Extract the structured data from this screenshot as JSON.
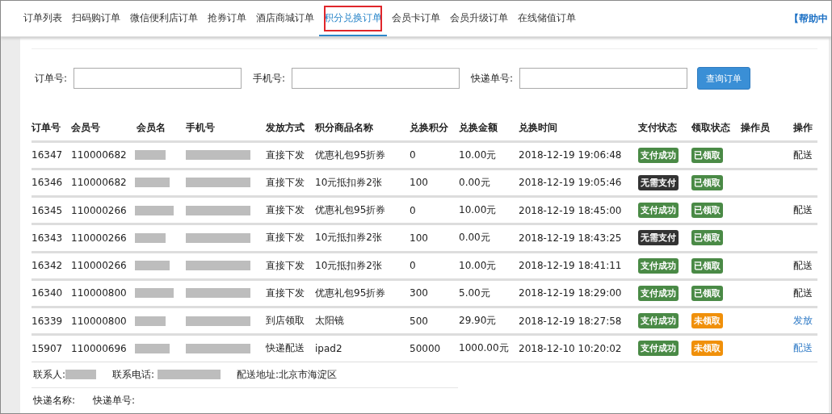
{
  "tabs": [
    {
      "label": "订单列表",
      "selected": false
    },
    {
      "label": "扫码购订单",
      "selected": false
    },
    {
      "label": "微信便利店订单",
      "selected": false
    },
    {
      "label": "抢券订单",
      "selected": false
    },
    {
      "label": "酒店商城订单",
      "selected": false
    },
    {
      "label": "积分兑换订单",
      "selected": true
    },
    {
      "label": "会员卡订单",
      "selected": false
    },
    {
      "label": "会员升级订单",
      "selected": false
    },
    {
      "label": "在线储值订单",
      "selected": false
    }
  ],
  "help_link": "【帮助中",
  "search": {
    "fields": [
      {
        "label": "订单号:"
      },
      {
        "label": "手机号:"
      },
      {
        "label": "快递单号:"
      }
    ],
    "button": "查询订单"
  },
  "table": {
    "columns": [
      "订单号",
      "会员号",
      "会员名",
      "手机号",
      "发放方式",
      "积分商品名称",
      "兑换积分",
      "兑换金额",
      "兑换时间",
      "支付状态",
      "领取状态",
      "操作员",
      "操作"
    ],
    "rows": [
      {
        "order_no": "16347",
        "member_no": "110000682",
        "method": "直接下发",
        "product": "优惠礼包95折券",
        "points": "0",
        "amount": "10.00元",
        "time": "2018-12-19 19:06:48",
        "pay_status": {
          "text": "支付成功",
          "color": "#4a8a46"
        },
        "pickup_status": {
          "text": "已领取",
          "color": "#4a8a46"
        },
        "action": {
          "text": "配送",
          "kind": "text"
        }
      },
      {
        "order_no": "16346",
        "member_no": "110000682",
        "method": "直接下发",
        "product": "10元抵扣券2张",
        "points": "100",
        "amount": "0.00元",
        "time": "2018-12-19 19:05:46",
        "pay_status": {
          "text": "无需支付",
          "color": "#333333"
        },
        "pickup_status": {
          "text": "已领取",
          "color": "#4a8a46"
        }
      },
      {
        "order_no": "16345",
        "member_no": "110000266",
        "method": "直接下发",
        "product": "优惠礼包95折券",
        "points": "0",
        "amount": "10.00元",
        "time": "2018-12-19 18:45:00",
        "pay_status": {
          "text": "支付成功",
          "color": "#4a8a46"
        },
        "pickup_status": {
          "text": "已领取",
          "color": "#4a8a46"
        },
        "action": {
          "text": "配送",
          "kind": "text"
        }
      },
      {
        "order_no": "16343",
        "member_no": "110000266",
        "method": "直接下发",
        "product": "10元抵扣券2张",
        "points": "100",
        "amount": "0.00元",
        "time": "2018-12-19 18:43:25",
        "pay_status": {
          "text": "无需支付",
          "color": "#333333"
        },
        "pickup_status": {
          "text": "已领取",
          "color": "#4a8a46"
        }
      },
      {
        "order_no": "16342",
        "member_no": "110000266",
        "method": "直接下发",
        "product": "10元抵扣券2张",
        "points": "0",
        "amount": "10.00元",
        "time": "2018-12-19 18:41:11",
        "pay_status": {
          "text": "支付成功",
          "color": "#4a8a46"
        },
        "pickup_status": {
          "text": "已领取",
          "color": "#4a8a46"
        },
        "action": {
          "text": "配送",
          "kind": "text"
        }
      },
      {
        "order_no": "16340",
        "member_no": "110000800",
        "method": "直接下发",
        "product": "优惠礼包95折券",
        "points": "300",
        "amount": "5.00元",
        "time": "2018-12-19 18:29:00",
        "pay_status": {
          "text": "支付成功",
          "color": "#4a8a46"
        },
        "pickup_status": {
          "text": "已领取",
          "color": "#4a8a46"
        },
        "action": {
          "text": "配送",
          "kind": "text"
        }
      },
      {
        "order_no": "16339",
        "member_no": "110000800",
        "method": "到店领取",
        "product": "太阳镜",
        "points": "500",
        "amount": "29.90元",
        "time": "2018-12-19 18:27:58",
        "pay_status": {
          "text": "支付成功",
          "color": "#4a8a46"
        },
        "pickup_status": {
          "text": "未领取",
          "color": "#f0900a"
        },
        "action": {
          "text": "发放",
          "kind": "link"
        }
      },
      {
        "order_no": "15907",
        "member_no": "110000696",
        "method": "快递配送",
        "product": "ipad2",
        "points": "50000",
        "amount": "1000.00元",
        "time": "2018-12-10 10:20:02",
        "pay_status": {
          "text": "支付成功",
          "color": "#4a8a46"
        },
        "pickup_status": {
          "text": "未领取",
          "color": "#f0900a"
        },
        "action": {
          "text": "配送",
          "kind": "link"
        }
      }
    ]
  },
  "delivery": {
    "contact_label": "联系人:",
    "phone_label": "联系电话:",
    "address": "配送地址:北京市海淀区",
    "courier_label": "快递名称:",
    "tracking_label": "快递单号:"
  }
}
